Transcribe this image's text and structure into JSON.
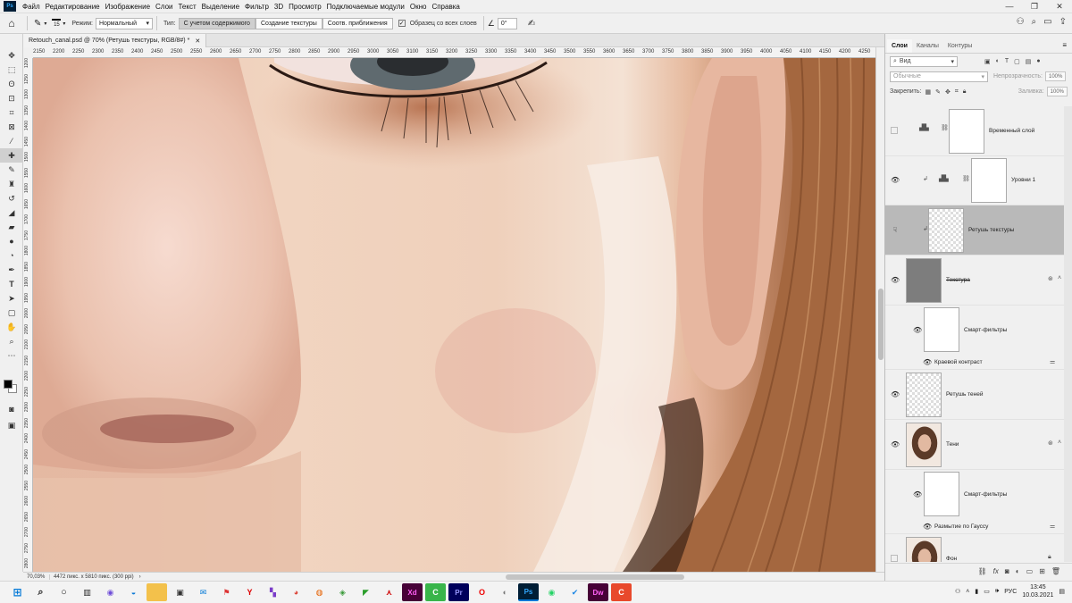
{
  "app": {
    "logo": "Ps"
  },
  "menu": [
    "Файл",
    "Редактирование",
    "Изображение",
    "Слои",
    "Текст",
    "Выделение",
    "Фильтр",
    "3D",
    "Просмотр",
    "Подключаемые модули",
    "Окно",
    "Справка"
  ],
  "options": {
    "brush_size": "15",
    "mode_label": "Режим:",
    "mode_value": "Нормальный",
    "type_label": "Тип:",
    "type_options": [
      "С учетом содержимого",
      "Создание текстуры",
      "Соотв. приближения"
    ],
    "sample_all_label": "Образец со всех слоев",
    "angle_value": "0°"
  },
  "document": {
    "tab_title": "Retouch_canal.psd @ 70% (Ретушь текстуры, RGB/8#) *",
    "zoom": "70,03%",
    "info": "4472 пикс. x 5810 пикс. (300 ppi)"
  },
  "ruler_h": [
    "2150",
    "2200",
    "2250",
    "2300",
    "2350",
    "2400",
    "2450",
    "2500",
    "2550",
    "2600",
    "2650",
    "2700",
    "2750",
    "2800",
    "2850",
    "2900",
    "2950",
    "3000",
    "3050",
    "3100",
    "3150",
    "3200",
    "3250",
    "3300",
    "3350",
    "3400",
    "3450",
    "3500",
    "3550",
    "3600",
    "3650",
    "3700",
    "3750",
    "3800",
    "3850",
    "3900",
    "3950",
    "4000",
    "4050",
    "4100",
    "4150",
    "4200",
    "4250"
  ],
  "ruler_v": [
    "1200",
    "1250",
    "1300",
    "1350",
    "1400",
    "1450",
    "1500",
    "1550",
    "1600",
    "1650",
    "1700",
    "1750",
    "1800",
    "1850",
    "1900",
    "1950",
    "2000",
    "2050",
    "2100",
    "2150",
    "2200",
    "2250",
    "2300",
    "2350",
    "2400",
    "2450",
    "2500",
    "2550",
    "2600",
    "2650",
    "2700",
    "2750",
    "2800"
  ],
  "panel": {
    "tabs": [
      "Слои",
      "Каналы",
      "Контуры"
    ],
    "filter_value": "Вид",
    "blend_mode": "Обычные",
    "opacity_label": "Непрозрачность:",
    "opacity_value": "100%",
    "lock_label": "Закрепить:",
    "fill_label": "Заливка:",
    "fill_value": "100%"
  },
  "layers": [
    {
      "name": "Временный слой"
    },
    {
      "name": "Уровни 1"
    },
    {
      "name": "Ретушь текстуры"
    },
    {
      "name": "Текстура"
    },
    {
      "name": "Смарт-фильтры"
    },
    {
      "name": "Краевой контраст"
    },
    {
      "name": "Ретушь теней"
    },
    {
      "name": "Тени"
    },
    {
      "name": "Смарт-фильтры"
    },
    {
      "name": "Размытие по Гауссу"
    },
    {
      "name": "Фон"
    }
  ],
  "taskbar": {
    "lang": "РУС",
    "time": "13:45",
    "date": "10.03.2021"
  }
}
